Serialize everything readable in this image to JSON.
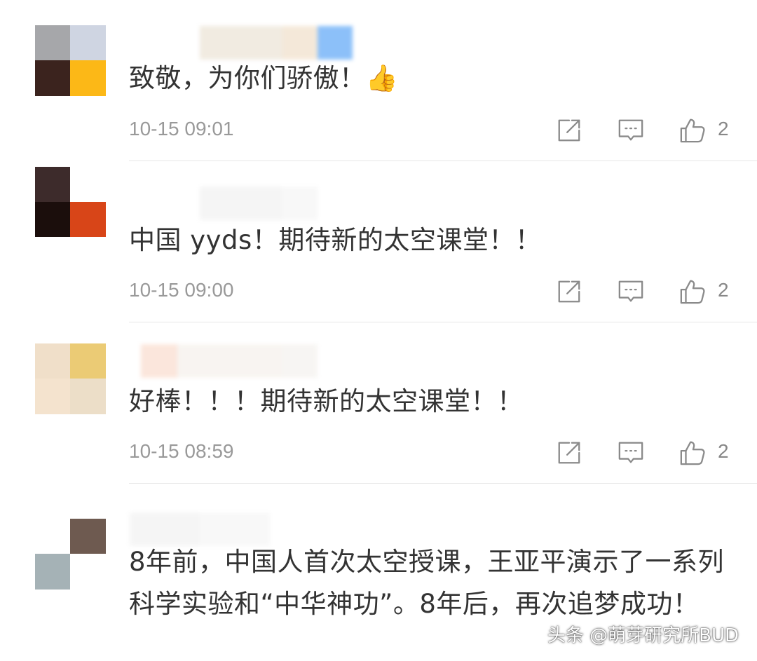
{
  "comments": [
    {
      "text": "致敬，为你们骄傲！👍",
      "time": "10-15 09:01",
      "likes": "2",
      "avatar_colors": [
        "#a6a7aa",
        "#cfd5e2",
        "#3b231e",
        "#fcb817"
      ],
      "username_colors": [
        "#ffffff",
        "#efe8dc",
        "#f3e5d3",
        "#79b6f8"
      ]
    },
    {
      "text": "中国 yyds！期待新的太空课堂！！",
      "time": "10-15 09:00",
      "likes": "2",
      "avatar_colors": [
        "#3d2b2b",
        "#ffffff",
        "#1b0e0c",
        "#d84518"
      ],
      "username_colors": [
        "#ffffff",
        "#f4f4f4",
        "#f7f7f7",
        "#ffffff"
      ]
    },
    {
      "text": "好棒！！！期待新的太空课堂！！",
      "time": "10-15 08:59",
      "likes": "2",
      "avatar_colors": [
        "#f0dfc9",
        "#ebcb75",
        "#f4e3ce",
        "#ecdec8"
      ],
      "username_colors": [
        "#ffffff",
        "#fbe2d6",
        "#f7f3ef",
        "#f6f4f1"
      ]
    },
    {
      "text": "8年前，中国人首次太空授课，王亚平演示了一系列科学实验和“中华神功”。8年后，再次追梦成功！",
      "avatar_colors": [
        "#ffffff",
        "#6e5a50",
        "#a5b2b6",
        "#ffffff"
      ],
      "username_colors": [
        "#f4f4f4",
        "#f7f7f7",
        "#ffffff",
        "#ffffff"
      ]
    }
  ],
  "icons": {
    "share": "share-icon",
    "reply": "comment-reply-icon",
    "like": "thumbs-up-icon"
  },
  "watermark": "头条 @萌芽研究所BUD",
  "colors": {
    "text": "#333333",
    "meta": "#999999",
    "icon": "#8a8a8a",
    "divider": "#e6e6e6"
  }
}
